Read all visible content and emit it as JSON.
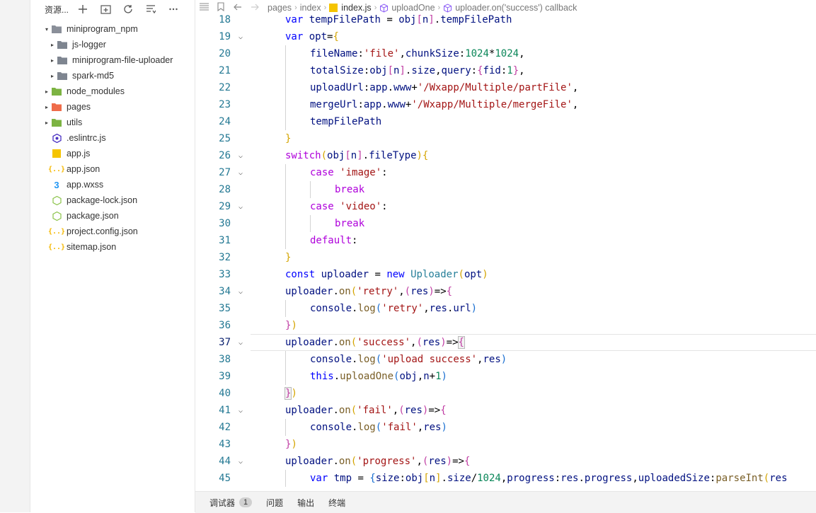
{
  "explorer": {
    "title": "资源...",
    "tree": [
      {
        "label": "miniprogram_npm",
        "depth": 0,
        "kind": "folder-open",
        "icon": "npm-folder-icon",
        "iconColor": "#8a8f99",
        "name": "tree-folder-miniprogram-npm"
      },
      {
        "label": "js-logger",
        "depth": 1,
        "kind": "folder",
        "icon": "folder-icon",
        "iconColor": "#7e8590",
        "name": "tree-folder-js-logger"
      },
      {
        "label": "miniprogram-file-uploader",
        "depth": 1,
        "kind": "folder",
        "icon": "folder-icon",
        "iconColor": "#7e8590",
        "name": "tree-folder-miniprogram-file-uploader"
      },
      {
        "label": "spark-md5",
        "depth": 1,
        "kind": "folder",
        "icon": "folder-icon",
        "iconColor": "#7e8590",
        "name": "tree-folder-spark-md5"
      },
      {
        "label": "node_modules",
        "depth": 0,
        "kind": "folder",
        "icon": "node-folder-icon",
        "iconColor": "#7cb342",
        "name": "tree-folder-node-modules"
      },
      {
        "label": "pages",
        "depth": 0,
        "kind": "folder",
        "icon": "pages-folder-icon",
        "iconColor": "#ef6c4a",
        "name": "tree-folder-pages"
      },
      {
        "label": "utils",
        "depth": 0,
        "kind": "folder",
        "icon": "utils-folder-icon",
        "iconColor": "#7cb342",
        "name": "tree-folder-utils"
      },
      {
        "label": ".eslintrc.js",
        "depth": 0,
        "kind": "file",
        "icon": "eslint-icon",
        "iconColor": "#4b32c3",
        "name": "tree-file-eslintrc"
      },
      {
        "label": "app.js",
        "depth": 0,
        "kind": "file",
        "icon": "js-file-icon",
        "iconColor": "#f5c400",
        "name": "tree-file-app-js"
      },
      {
        "label": "app.json",
        "depth": 0,
        "kind": "file",
        "icon": "json-file-icon",
        "iconColor": "#f5b800",
        "name": "tree-file-app-json"
      },
      {
        "label": "app.wxss",
        "depth": 0,
        "kind": "file",
        "icon": "css-file-icon",
        "iconColor": "#2196f3",
        "name": "tree-file-app-wxss"
      },
      {
        "label": "package-lock.json",
        "depth": 0,
        "kind": "file",
        "icon": "node-package-icon",
        "iconColor": "#8bc34a",
        "name": "tree-file-package-lock"
      },
      {
        "label": "package.json",
        "depth": 0,
        "kind": "file",
        "icon": "node-package-icon",
        "iconColor": "#8bc34a",
        "name": "tree-file-package-json"
      },
      {
        "label": "project.config.json",
        "depth": 0,
        "kind": "file",
        "icon": "json-file-icon",
        "iconColor": "#f5b800",
        "name": "tree-file-project-config"
      },
      {
        "label": "sitemap.json",
        "depth": 0,
        "kind": "file",
        "icon": "json-file-icon",
        "iconColor": "#f5b800",
        "name": "tree-file-sitemap"
      }
    ]
  },
  "breadcrumb": [
    "pages",
    "index",
    "index.js",
    "uploadOne",
    "uploader.on('success') callback"
  ],
  "code": {
    "activeLine": 37,
    "lines": [
      {
        "n": 18,
        "indent": 2,
        "fold": false,
        "html": "<span class=\"k\">var</span> <span class=\"p\">tempFilePath</span> = <span class=\"p\">obj</span><span class=\"b2\">[</span><span class=\"p\">n</span><span class=\"b2\">]</span>.<span class=\"p\">tempFilePath</span>"
      },
      {
        "n": 19,
        "indent": 2,
        "fold": true,
        "html": "<span class=\"k\">var</span> <span class=\"p\">opt</span>=<span class=\"b1\">{</span>"
      },
      {
        "n": 20,
        "indent": 3,
        "fold": false,
        "html": "<span class=\"p\">fileName</span>:<span class=\"s\">'file'</span>,<span class=\"p\">chunkSize</span>:<span class=\"n\">1024</span>*<span class=\"n\">1024</span>,"
      },
      {
        "n": 21,
        "indent": 3,
        "fold": false,
        "html": "<span class=\"p\">totalSize</span>:<span class=\"p\">obj</span><span class=\"b2\">[</span><span class=\"p\">n</span><span class=\"b2\">]</span>.<span class=\"p\">size</span>,<span class=\"p\">query</span>:<span class=\"b2\">{</span><span class=\"p\">fid</span>:<span class=\"n\">1</span><span class=\"b2\">}</span>,"
      },
      {
        "n": 22,
        "indent": 3,
        "fold": false,
        "html": "<span class=\"p\">uploadUrl</span>:<span class=\"p\">app</span>.<span class=\"p\">www</span>+<span class=\"s\">'/Wxapp/Multiple/partFile'</span>,"
      },
      {
        "n": 23,
        "indent": 3,
        "fold": false,
        "html": "<span class=\"p\">mergeUrl</span>:<span class=\"p\">app</span>.<span class=\"p\">www</span>+<span class=\"s\">'/Wxapp/Multiple/mergeFile'</span>,"
      },
      {
        "n": 24,
        "indent": 3,
        "fold": false,
        "html": "<span class=\"p\">tempFilePath</span>"
      },
      {
        "n": 25,
        "indent": 2,
        "fold": false,
        "html": "<span class=\"b1\">}</span>"
      },
      {
        "n": 26,
        "indent": 2,
        "fold": true,
        "html": "<span class=\"kw\">switch</span><span class=\"b1\">(</span><span class=\"p\">obj</span><span class=\"b2\">[</span><span class=\"p\">n</span><span class=\"b2\">]</span>.<span class=\"p\">fileType</span><span class=\"b1\">){</span>"
      },
      {
        "n": 27,
        "indent": 3,
        "fold": true,
        "html": "<span class=\"kw\">case</span> <span class=\"s\">'image'</span>:"
      },
      {
        "n": 28,
        "indent": 4,
        "fold": false,
        "html": "<span class=\"kw\">break</span>"
      },
      {
        "n": 29,
        "indent": 3,
        "fold": true,
        "html": "<span class=\"kw\">case</span> <span class=\"s\">'video'</span>:"
      },
      {
        "n": 30,
        "indent": 4,
        "fold": false,
        "html": "<span class=\"kw\">break</span>"
      },
      {
        "n": 31,
        "indent": 3,
        "fold": false,
        "html": "<span class=\"kw\">default</span>:"
      },
      {
        "n": 32,
        "indent": 2,
        "fold": false,
        "html": "<span class=\"b1\">}</span>"
      },
      {
        "n": 33,
        "indent": 2,
        "fold": false,
        "html": "<span class=\"k\">const</span> <span class=\"p\">uploader</span> = <span class=\"k\">new</span> <span class=\"t\">Uploader</span><span class=\"b1\">(</span><span class=\"p\">opt</span><span class=\"b1\">)</span>"
      },
      {
        "n": 34,
        "indent": 2,
        "fold": true,
        "html": "<span class=\"p\">uploader</span>.<span class=\"f\">on</span><span class=\"b1\">(</span><span class=\"s\">'retry'</span>,<span class=\"b2\">(</span><span class=\"p\">res</span><span class=\"b2\">)</span>=><span class=\"b2\">{</span>"
      },
      {
        "n": 35,
        "indent": 3,
        "fold": false,
        "html": "<span class=\"p\">console</span>.<span class=\"f\">log</span><span class=\"b3\">(</span><span class=\"s\">'retry'</span>,<span class=\"p\">res</span>.<span class=\"p\">url</span><span class=\"b3\">)</span>"
      },
      {
        "n": 36,
        "indent": 2,
        "fold": false,
        "html": "<span class=\"b2\">}</span><span class=\"b1\">)</span>"
      },
      {
        "n": 37,
        "indent": 2,
        "fold": true,
        "html": "<span class=\"p\">uploader</span>.<span class=\"f\">on</span><span class=\"b1\">(</span><span class=\"s\">'success'</span>,<span class=\"b2\">(</span><span class=\"p\">res</span><span class=\"b2\">)</span>=><span class=\"b2 bm\">{</span>"
      },
      {
        "n": 38,
        "indent": 3,
        "fold": false,
        "html": "<span class=\"p\">console</span>.<span class=\"f\">log</span><span class=\"b3\">(</span><span class=\"s\">'upload success'</span>,<span class=\"p\">res</span><span class=\"b3\">)</span>"
      },
      {
        "n": 39,
        "indent": 3,
        "fold": false,
        "html": "<span class=\"k\">this</span>.<span class=\"f\">uploadOne</span><span class=\"b3\">(</span><span class=\"p\">obj</span>,<span class=\"p\">n</span>+<span class=\"n\">1</span><span class=\"b3\">)</span>"
      },
      {
        "n": 40,
        "indent": 2,
        "fold": false,
        "html": "<span class=\"b2 bm\">}</span><span class=\"b1\">)</span>"
      },
      {
        "n": 41,
        "indent": 2,
        "fold": true,
        "html": "<span class=\"p\">uploader</span>.<span class=\"f\">on</span><span class=\"b1\">(</span><span class=\"s\">'fail'</span>,<span class=\"b2\">(</span><span class=\"p\">res</span><span class=\"b2\">)</span>=><span class=\"b2\">{</span>"
      },
      {
        "n": 42,
        "indent": 3,
        "fold": false,
        "html": "<span class=\"p\">console</span>.<span class=\"f\">log</span><span class=\"b3\">(</span><span class=\"s\">'fail'</span>,<span class=\"p\">res</span><span class=\"b3\">)</span>"
      },
      {
        "n": 43,
        "indent": 2,
        "fold": false,
        "html": "<span class=\"b2\">}</span><span class=\"b1\">)</span>"
      },
      {
        "n": 44,
        "indent": 2,
        "fold": true,
        "html": "<span class=\"p\">uploader</span>.<span class=\"f\">on</span><span class=\"b1\">(</span><span class=\"s\">'progress'</span>,<span class=\"b2\">(</span><span class=\"p\">res</span><span class=\"b2\">)</span>=><span class=\"b2\">{</span>"
      },
      {
        "n": 45,
        "indent": 3,
        "fold": false,
        "html": "<span class=\"k\">var</span> <span class=\"p\">tmp</span> = <span class=\"b3\">{</span><span class=\"p\">size</span>:<span class=\"p\">obj</span><span class=\"b1\">[</span><span class=\"p\">n</span><span class=\"b1\">]</span>.<span class=\"p\">size</span>/<span class=\"n\">1024</span>,<span class=\"p\">progress</span>:<span class=\"p\">res</span>.<span class=\"p\">progress</span>,<span class=\"p\">uploadedSize</span>:<span class=\"f\">parseInt</span><span class=\"b1\">(</span><span class=\"p\">res</span>"
      }
    ]
  },
  "bottom": {
    "tabs": [
      {
        "label": "调试器",
        "badge": "1",
        "name": "tab-debugger"
      },
      {
        "label": "问题",
        "name": "tab-problems"
      },
      {
        "label": "输出",
        "name": "tab-output"
      },
      {
        "label": "终端",
        "name": "tab-terminal"
      }
    ]
  }
}
